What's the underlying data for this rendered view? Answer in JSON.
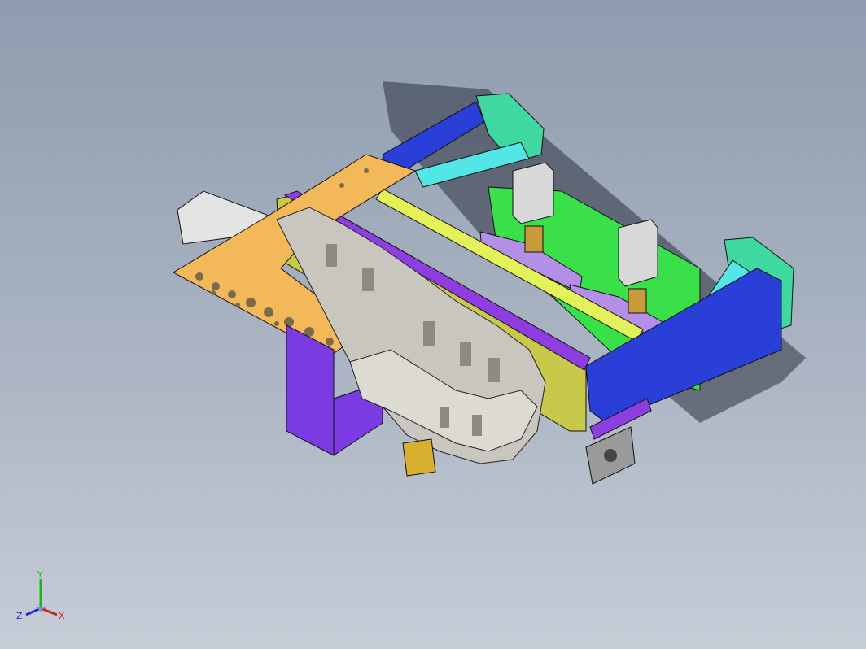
{
  "viewport": {
    "background_top": "#8f9caf",
    "background_bottom": "#c7cdd7"
  },
  "model": {
    "description_icon": "cad-assembly",
    "colors": {
      "frame_blue": "#2a3fd8",
      "bracket_green": "#3fd8a0",
      "gusset_cyan": "#52e6e6",
      "plate_orange": "#f2b85a",
      "rail_purple": "#8e3ee0",
      "rod_yellow": "#e4f25a",
      "olive": "#c8c84a",
      "slider_lavender": "#b58ee8",
      "cylinder_green": "#3ae04a",
      "cylinder_grey": "#d8d8d8",
      "chain_grey": "#c8c6be",
      "motor_grey": "#9a9a9a",
      "bracket_violet": "#7a3ce0"
    }
  },
  "triad": {
    "x_label": "X",
    "y_label": "Y",
    "z_label": "Z",
    "x_color": "#d02020",
    "y_color": "#20b020",
    "z_color": "#2030d0"
  }
}
